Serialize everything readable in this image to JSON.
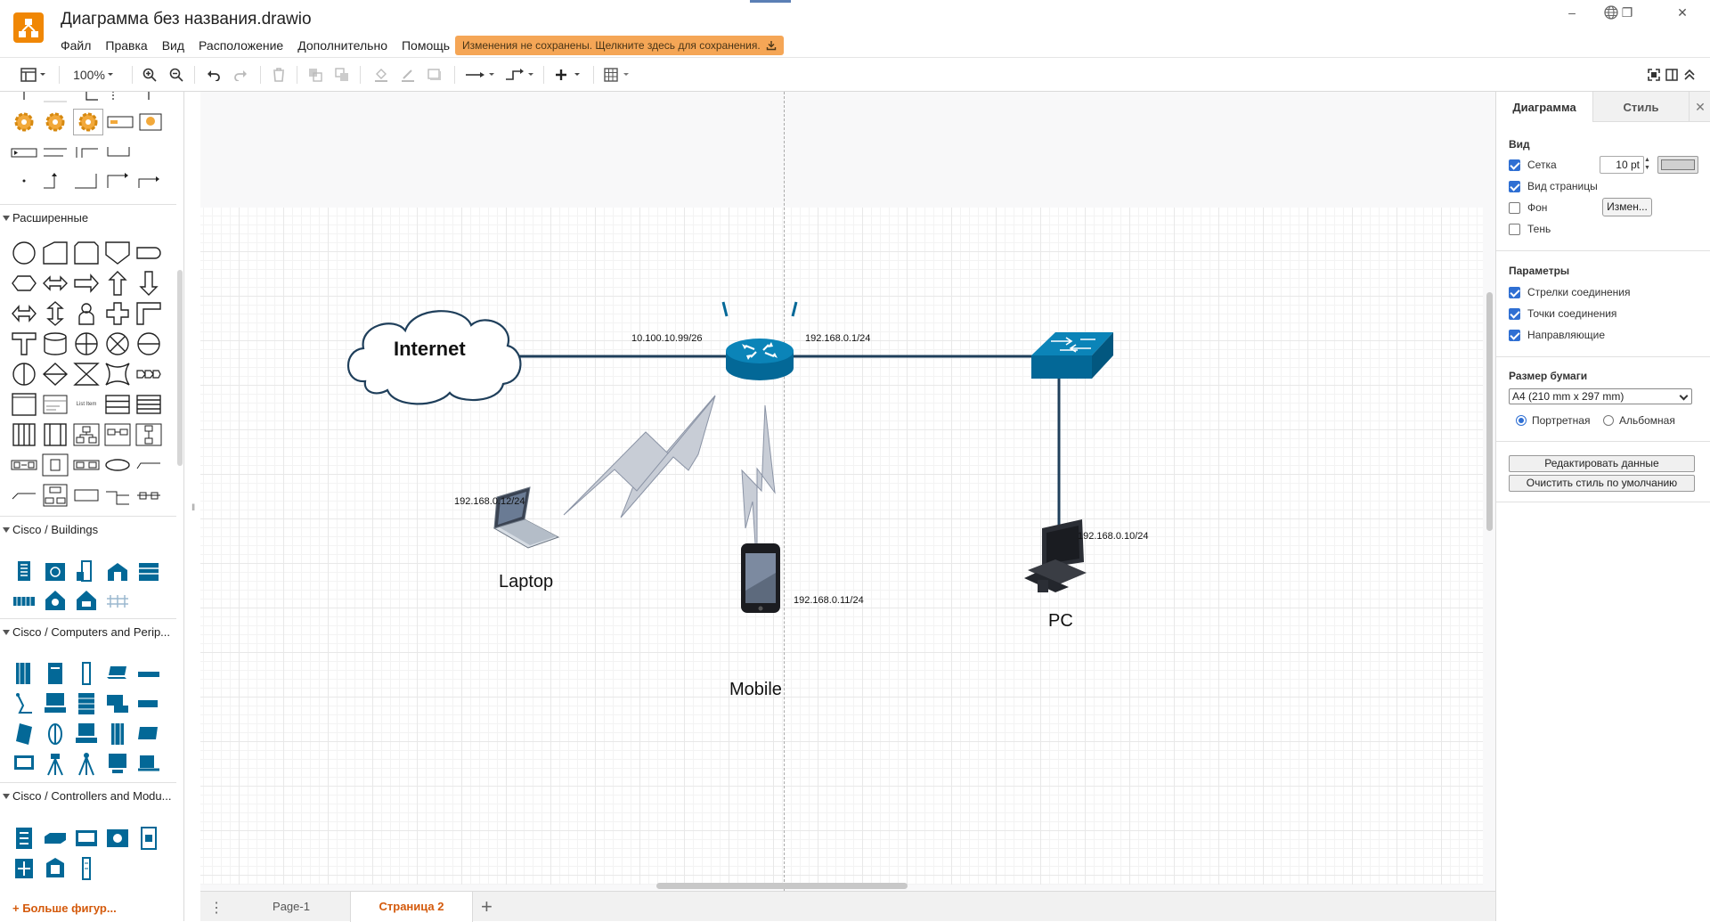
{
  "app": {
    "doc_title": "Диаграмма без названия.drawio",
    "menu": [
      "Файл",
      "Правка",
      "Вид",
      "Расположение",
      "Дополнительно",
      "Помощь"
    ],
    "unsaved_banner": "Изменения не сохранены. Щелкните здесь для сохранения.",
    "window_controls": [
      "minimize-icon",
      "restore-icon",
      "close-icon"
    ]
  },
  "toolbar": {
    "zoom": "100%",
    "icons": [
      "format-panel-icon",
      "zoom-in-icon",
      "zoom-out-icon",
      "undo-icon",
      "redo-icon",
      "delete-icon",
      "to-front-icon",
      "to-back-icon",
      "fill-color-icon",
      "line-color-icon",
      "shadow-icon",
      "connection-icon",
      "waypoints-icon",
      "insert-icon",
      "table-icon",
      "fullscreen-icon",
      "format-toggle-icon",
      "collapse-icon"
    ]
  },
  "left_panel": {
    "sections": [
      {
        "title": "Расширенные"
      },
      {
        "title": "Cisco / Buildings"
      },
      {
        "title": "Cisco / Computers and Perip..."
      },
      {
        "title": "Cisco / Controllers and Modu..."
      }
    ],
    "list_item_caption": "List Item",
    "more_shapes": "+ Больше фигур..."
  },
  "diagram": {
    "nodes": {
      "internet": "Internet",
      "laptop": "Laptop",
      "mobile": "Mobile",
      "pc": "PC"
    },
    "labels": {
      "router_wan": "10.100.10.99/26",
      "router_lan": "192.168.0.1/24",
      "laptop_ip": "192.168.0.12/24",
      "mobile_ip": "192.168.0.11/24",
      "pc_ip": "192.168.0.10/24"
    },
    "colors": {
      "link": "#1f3f5b",
      "device": "#036897",
      "wireless": "#c8cdd6"
    }
  },
  "pages": {
    "tabs": [
      "Page-1",
      "Страница 2"
    ],
    "active": "Страница 2"
  },
  "format_panel": {
    "tabs": {
      "diagram": "Диаграмма",
      "style": "Стиль"
    },
    "view": {
      "heading": "Вид",
      "grid": "Сетка",
      "grid_size": "10 pt",
      "page_view": "Вид страницы",
      "background": "Фон",
      "background_button": "Измен...",
      "shadow": "Тень"
    },
    "options": {
      "heading": "Параметры",
      "connection_arrows": "Стрелки соединения",
      "connection_points": "Точки соединения",
      "guides": "Направляющие"
    },
    "paper": {
      "heading": "Размер бумаги",
      "size": "A4 (210 mm x 297 mm)",
      "portrait": "Портретная",
      "landscape": "Альбомная"
    },
    "buttons": {
      "edit_data": "Редактировать данные",
      "clear_style": "Очистить стиль по умолчанию"
    }
  }
}
